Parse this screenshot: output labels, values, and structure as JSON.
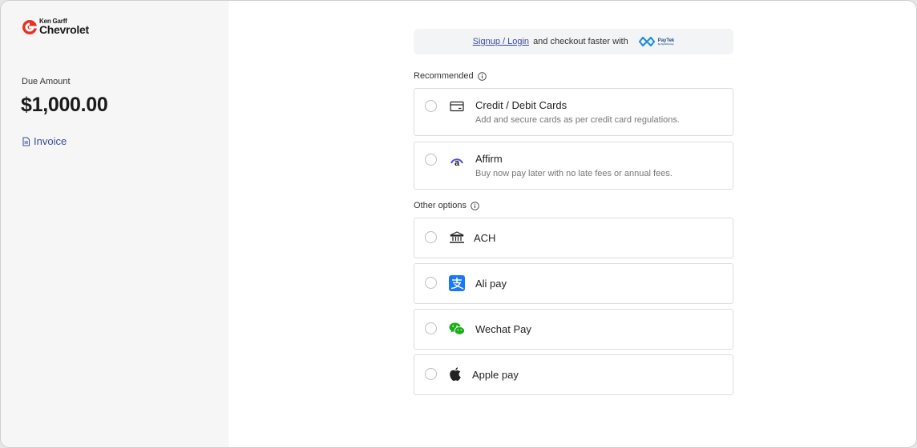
{
  "brand": {
    "line1": "Ken Garff",
    "line2": "Chevrolet",
    "color": "#e63323"
  },
  "sidebar": {
    "due_label": "Due Amount",
    "due_amount": "$1,000.00",
    "invoice_label": "Invoice"
  },
  "banner": {
    "link": "Signup / Login",
    "text": "and checkout faster with",
    "logo_text": "PayTek",
    "logo_sub": "by Synchrony"
  },
  "sections": {
    "recommended": "Recommended",
    "other": "Other options"
  },
  "recommended_options": [
    {
      "title": "Credit / Debit Cards",
      "desc": "Add and secure cards as per credit card regulations.",
      "icon": "credit-card-icon"
    },
    {
      "title": "Affirm",
      "desc": "Buy now pay later with no late fees or annual fees.",
      "icon": "affirm-icon"
    }
  ],
  "other_options": [
    {
      "title": "ACH",
      "icon": "bank-icon"
    },
    {
      "title": "Ali pay",
      "icon": "alipay-icon"
    },
    {
      "title": "Wechat Pay",
      "icon": "wechat-icon"
    },
    {
      "title": "Apple pay",
      "icon": "apple-icon"
    }
  ],
  "colors": {
    "accent": "#3b4a9c",
    "alipay": "#1677ff",
    "wechat": "#1aad19"
  }
}
